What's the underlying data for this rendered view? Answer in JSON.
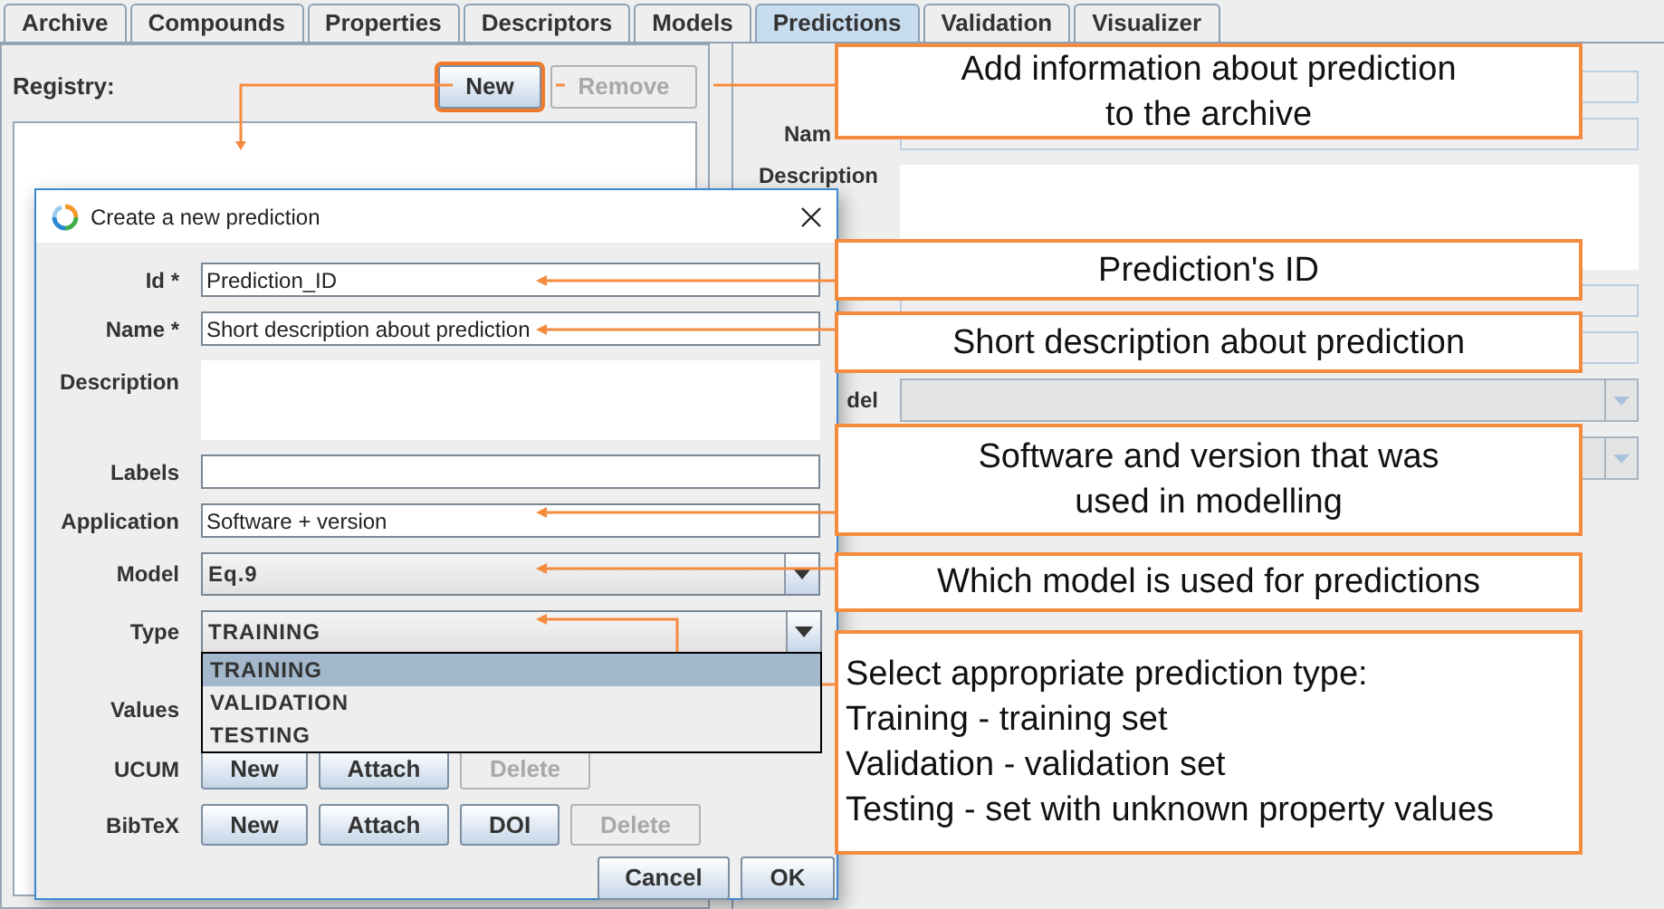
{
  "tabs": [
    {
      "label": "Archive",
      "selected": false
    },
    {
      "label": "Compounds",
      "selected": false
    },
    {
      "label": "Properties",
      "selected": false
    },
    {
      "label": "Descriptors",
      "selected": false
    },
    {
      "label": "Models",
      "selected": false
    },
    {
      "label": "Predictions",
      "selected": true
    },
    {
      "label": "Validation",
      "selected": false
    },
    {
      "label": "Visualizer",
      "selected": false
    }
  ],
  "registry": {
    "label": "Registry:",
    "buttons": [
      {
        "label": "New",
        "disabled": false,
        "highlighted": true
      },
      {
        "label": "Remove",
        "disabled": true,
        "highlighted": false
      }
    ]
  },
  "right_panel": {
    "rows": [
      {
        "kind": "field"
      },
      {
        "kind": "field",
        "label": "Nam"
      },
      {
        "kind": "textarea",
        "label": "Description"
      },
      {
        "kind": "field"
      },
      {
        "kind": "field"
      },
      {
        "kind": "combo",
        "label": "del"
      },
      {
        "kind": "combo"
      }
    ]
  },
  "dialog": {
    "title": "Create a new prediction",
    "fields": [
      {
        "kind": "text",
        "label": "Id *",
        "value": "Prediction_ID"
      },
      {
        "kind": "text",
        "label": "Name *",
        "value": "Short description about prediction"
      },
      {
        "kind": "textarea",
        "label": "Description"
      },
      {
        "kind": "text",
        "label": "Labels"
      },
      {
        "kind": "text",
        "label": "Application",
        "value": "Software + version"
      },
      {
        "kind": "combo",
        "label": "Model",
        "value": "Eq.9",
        "expanded": false
      },
      {
        "kind": "combo",
        "label": "Type",
        "value": "TRAINING",
        "expanded": true,
        "options": [
          {
            "label": "TRAINING",
            "selected": true
          },
          {
            "label": "VALIDATION",
            "selected": false
          },
          {
            "label": "TESTING",
            "selected": false
          }
        ]
      },
      {
        "kind": "label",
        "label": "Values"
      },
      {
        "kind": "buttons",
        "label": "UCUM",
        "buttons": [
          {
            "label": "New",
            "disabled": false
          },
          {
            "label": "Attach",
            "disabled": false
          },
          {
            "label": "Delete",
            "disabled": true
          }
        ]
      },
      {
        "kind": "buttons",
        "label": "BibTeX",
        "buttons": [
          {
            "label": "New",
            "disabled": false
          },
          {
            "label": "Attach",
            "disabled": false
          },
          {
            "label": "DOI",
            "disabled": false
          },
          {
            "label": "Delete",
            "disabled": true
          }
        ]
      }
    ],
    "buttons": [
      {
        "label": "Cancel"
      },
      {
        "label": "OK"
      }
    ]
  },
  "callouts": [
    {
      "kind": "note",
      "lines": [
        "Add information about prediction",
        "to the archive"
      ]
    },
    {
      "kind": "note",
      "lines": [
        "Prediction's ID"
      ]
    },
    {
      "kind": "note",
      "lines": [
        "Short description about prediction"
      ]
    },
    {
      "kind": "note",
      "lines": [
        "Software and version that was",
        "used in modelling"
      ]
    },
    {
      "kind": "note",
      "lines": [
        "Which model is used for predictions"
      ]
    },
    {
      "kind": "list",
      "lines": [
        "Select appropriate prediction type:",
        "Training - training set",
        "Validation - validation set",
        "Testing - set with unknown property values"
      ]
    }
  ]
}
